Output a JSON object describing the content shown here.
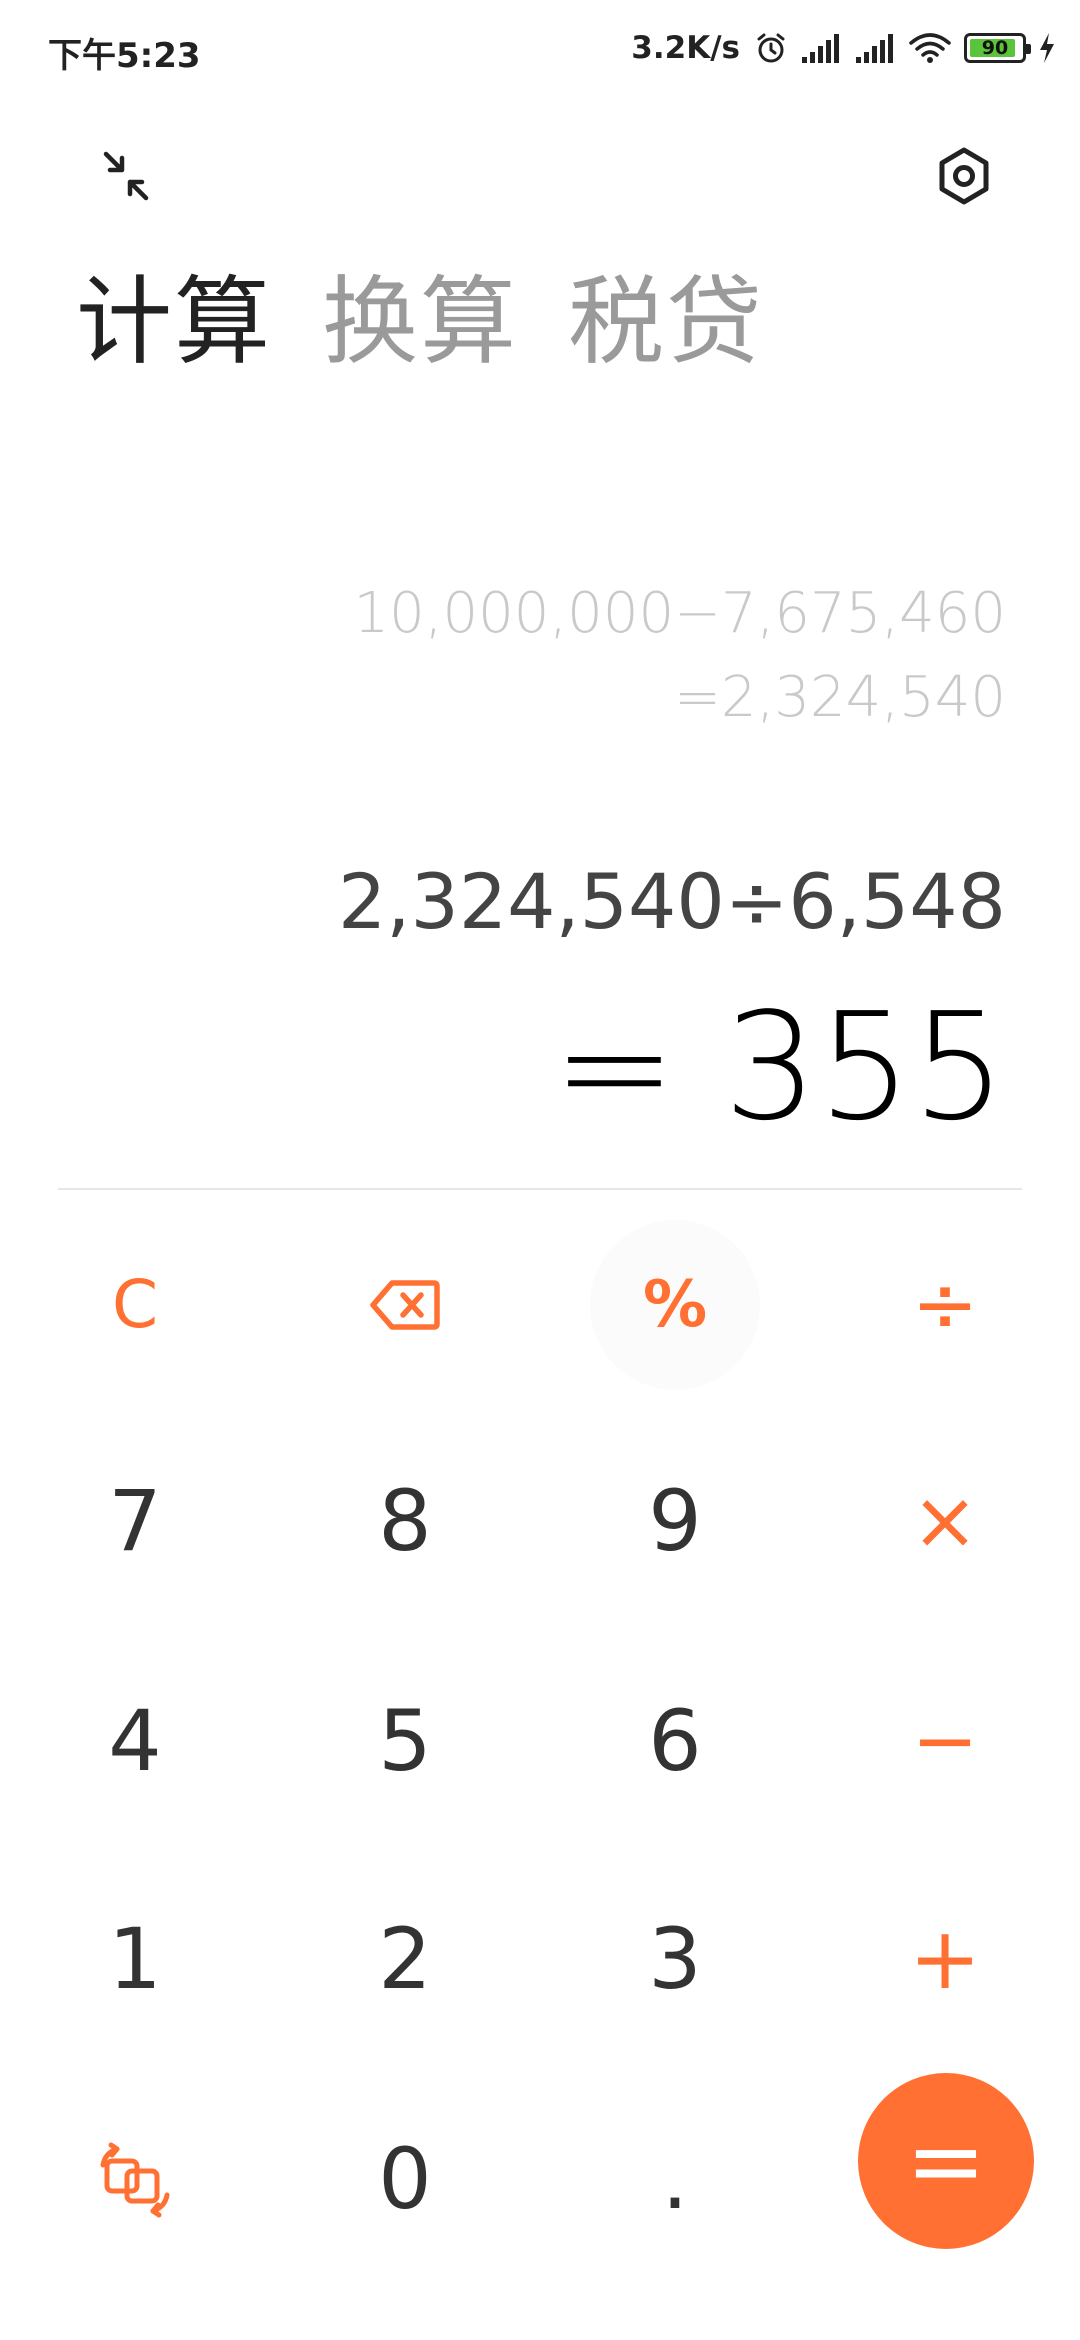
{
  "status_bar": {
    "time": "下午5:23",
    "net_speed": "3.2K/s",
    "battery_level": "90",
    "battery_fraction": 0.9,
    "icons": [
      "alarm-icon",
      "signal-icon",
      "signal-icon",
      "wifi-icon",
      "battery-icon",
      "charging-icon"
    ]
  },
  "header": {
    "collapse_icon": "collapse-icon",
    "settings_icon": "hexagon-settings-icon"
  },
  "tabs": [
    {
      "label": "计算",
      "active": true
    },
    {
      "label": "换算",
      "active": false
    },
    {
      "label": "税贷",
      "active": false
    }
  ],
  "display": {
    "history_expression": "10,000,000−7,675,460",
    "history_result": "=2,324,540",
    "expression": "2,324,540÷6,548",
    "result": "= 355"
  },
  "keypad": {
    "clear": "C",
    "percent": "%",
    "divide": "÷",
    "multiply": "×",
    "minus": "−",
    "plus": "+",
    "equals": "=",
    "decimal": ".",
    "digits": [
      "0",
      "1",
      "2",
      "3",
      "4",
      "5",
      "6",
      "7",
      "8",
      "9"
    ]
  },
  "colors": {
    "accent": "#ff7032",
    "text_primary": "#000000",
    "text_secondary": "#444444",
    "history_text": "#c9c9c9",
    "tab_inactive": "#9a9a9a",
    "battery_fill": "#5ac43a"
  }
}
